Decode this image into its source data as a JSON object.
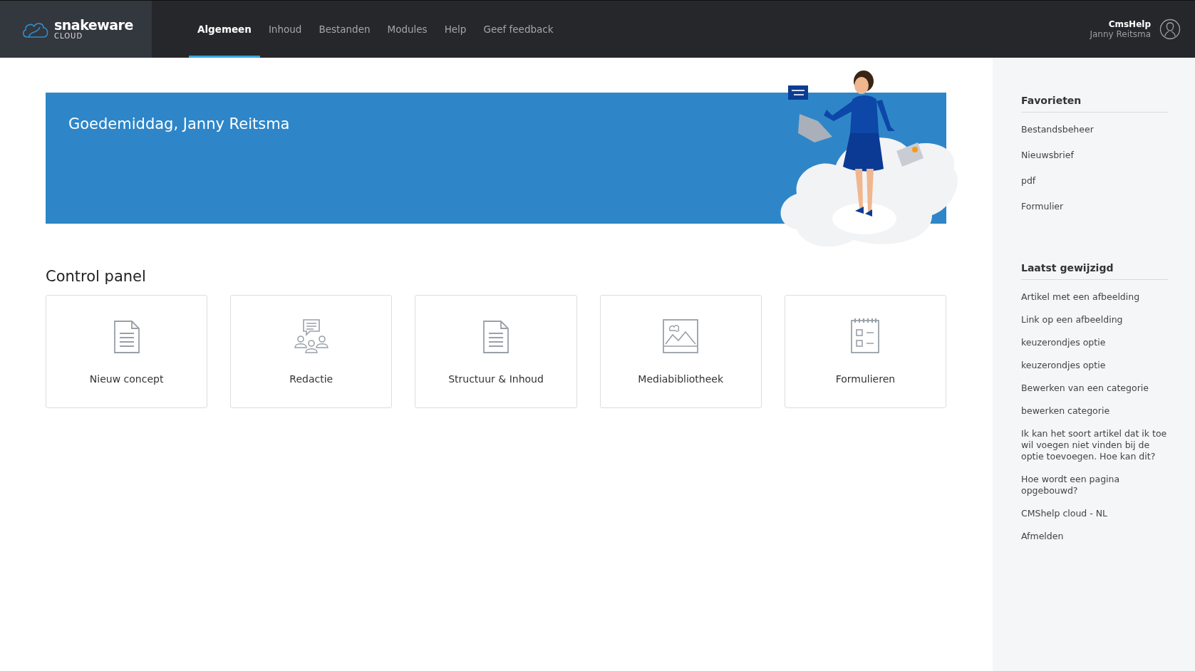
{
  "logo": {
    "name": "snakeware",
    "sub": "CLOUD"
  },
  "nav": [
    {
      "label": "Algemeen",
      "selected": true
    },
    {
      "label": "Inhoud",
      "selected": false
    },
    {
      "label": "Bestanden",
      "selected": false
    },
    {
      "label": "Modules",
      "selected": false
    },
    {
      "label": "Help",
      "selected": false
    },
    {
      "label": "Geef feedback",
      "selected": false
    }
  ],
  "user": {
    "site": "CmsHelp",
    "name": "Janny Reitsma"
  },
  "banner": {
    "greeting": "Goedemiddag, Janny Reitsma"
  },
  "control_panel": {
    "title": "Control panel",
    "tiles": [
      {
        "kind": "document",
        "label": "Nieuw concept"
      },
      {
        "kind": "team",
        "label": "Redactie"
      },
      {
        "kind": "document",
        "label": "Structuur & Inhoud"
      },
      {
        "kind": "image",
        "label": "Mediabibliotheek"
      },
      {
        "kind": "form",
        "label": "Formulieren"
      }
    ]
  },
  "sidebar": {
    "sections": [
      {
        "title": "Favorieten",
        "items": [
          "Bestandsbeheer",
          "Nieuwsbrief",
          "pdf",
          "Formulier"
        ]
      },
      {
        "title": "Laatst gewijzigd",
        "items": [
          "Artikel met een afbeelding",
          "Link op een afbeelding",
          "keuzerondjes optie",
          "keuzerondjes optie",
          "Bewerken van een categorie",
          "bewerken categorie",
          "Ik kan het soort artikel dat ik toe wil voegen niet vinden bij de optie toevoegen. Hoe kan dit?",
          "Hoe wordt een pagina opgebouwd?",
          "CMShelp cloud - NL",
          "Afmelden"
        ]
      }
    ]
  }
}
